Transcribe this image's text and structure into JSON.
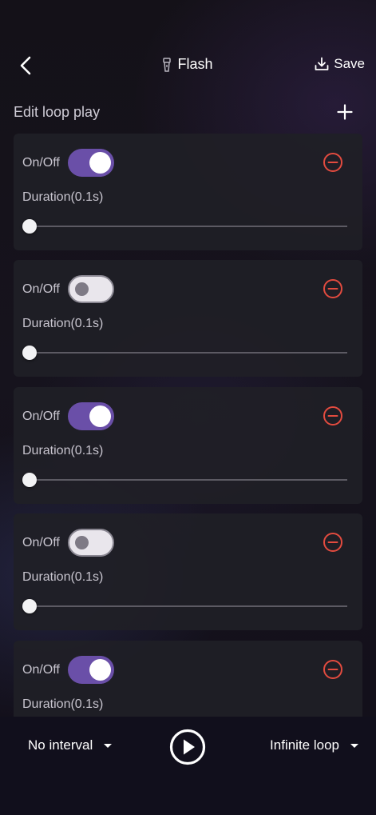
{
  "header": {
    "back_icon": "chevron-left-icon",
    "title_icon": "flashlight-icon",
    "title": "Flash",
    "save_icon": "download-icon",
    "save_label": "Save"
  },
  "section": {
    "title": "Edit loop play",
    "add_icon": "plus-icon"
  },
  "colors": {
    "accent": "#6a4fa8",
    "danger": "#e24b3f",
    "card_bg": "#201f26"
  },
  "items": [
    {
      "onoff_label": "On/Off",
      "enabled": true,
      "duration_label": "Duration(0.1s)",
      "duration_value": 0
    },
    {
      "onoff_label": "On/Off",
      "enabled": false,
      "duration_label": "Duration(0.1s)",
      "duration_value": 0
    },
    {
      "onoff_label": "On/Off",
      "enabled": true,
      "duration_label": "Duration(0.1s)",
      "duration_value": 0
    },
    {
      "onoff_label": "On/Off",
      "enabled": false,
      "duration_label": "Duration(0.1s)",
      "duration_value": 0
    },
    {
      "onoff_label": "On/Off",
      "enabled": true,
      "duration_label": "Duration(0.1s)",
      "duration_value": 0
    }
  ],
  "footer": {
    "interval_value": "No interval",
    "play_icon": "play-circle-icon",
    "loop_value": "Infinite loop"
  }
}
